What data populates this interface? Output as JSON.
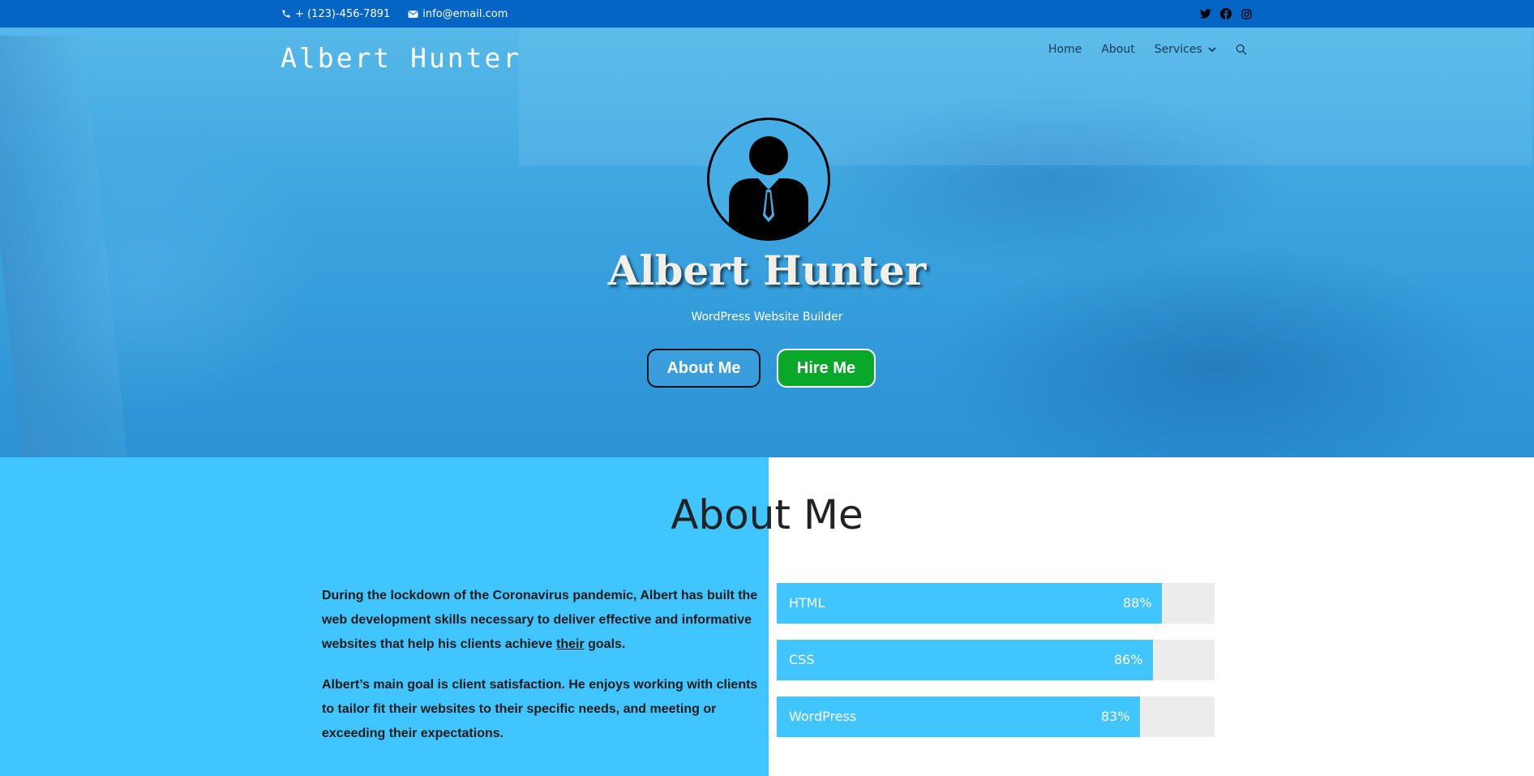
{
  "topbar": {
    "phone": "+ (123)-456-7891",
    "email": "info@email.com",
    "social_icons": [
      "twitter-icon",
      "facebook-icon",
      "instagram-icon"
    ]
  },
  "header": {
    "brand": "Albert Hunter",
    "nav": [
      {
        "label": "Home"
      },
      {
        "label": "About"
      },
      {
        "label": "Services"
      }
    ]
  },
  "hero": {
    "name": "Albert Hunter",
    "subtitle": "WordPress Website Builder",
    "about_button": "About Me",
    "hire_button": "Hire Me"
  },
  "about": {
    "title": "About Me",
    "p1_before": "During the lockdown of the Coronavirus pandemic, Albert has built the web development skills necessary to deliver effective and informative websites that help his clients achieve ",
    "p1_link": "their",
    "p1_after": " goals.",
    "p2": "Albert’s main goal is client satisfaction. He enjoys working with clients to tailor fit their websites to their specific needs, and meeting or exceeding their expectations.",
    "skills": [
      {
        "name": "HTML",
        "percent_label": "88%",
        "percent": 88
      },
      {
        "name": "CSS",
        "percent_label": "86%",
        "percent": 86
      },
      {
        "name": "WordPress",
        "percent_label": "83%",
        "percent": 83
      }
    ]
  },
  "colors": {
    "topbar": "#0565c4",
    "accent": "#40c5ff",
    "hire_button": "#0aa82a"
  }
}
